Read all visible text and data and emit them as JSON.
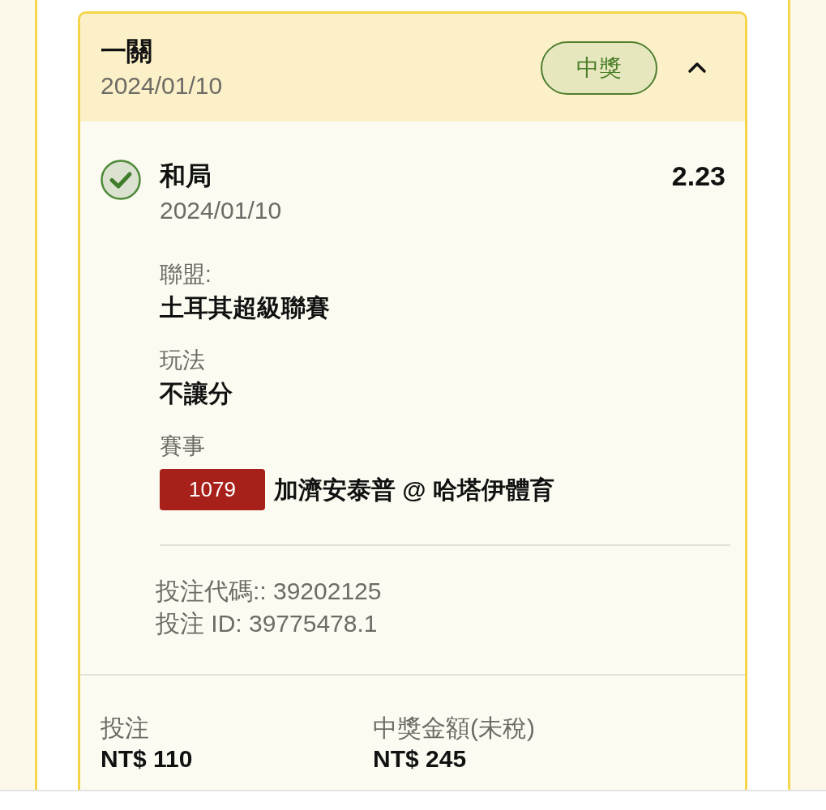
{
  "bet_card": {
    "title": "一關",
    "date": "2024/01/10",
    "status_badge": "中獎",
    "expanded": true,
    "selection": {
      "won": true,
      "name": "和局",
      "date": "2024/01/10",
      "odds": "2.23"
    },
    "details": [
      {
        "label": "聯盟:",
        "value": "土耳其超級聯賽"
      },
      {
        "label": "玩法",
        "value": "不讓分"
      },
      {
        "label": "賽事",
        "match_code": "1079",
        "value": "加濟安泰普 @ 哈塔伊體育"
      }
    ],
    "references": [
      "投注代碼:: 39202125",
      "投注 ID: 39775478.1"
    ],
    "summary": [
      {
        "label": "投注",
        "value": "NT$ 110"
      },
      {
        "label": "中獎金額(未稅)",
        "value": "NT$ 245"
      }
    ]
  }
}
